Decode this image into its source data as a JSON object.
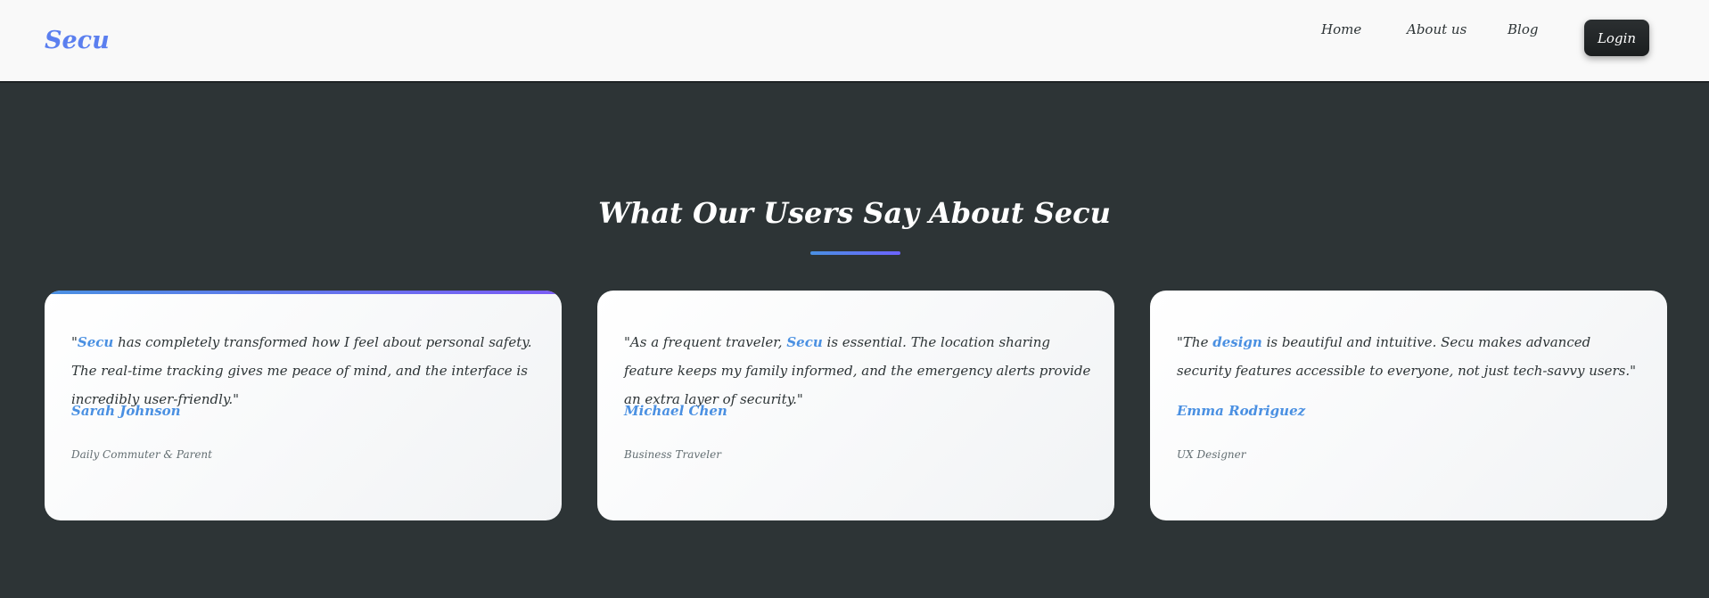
{
  "nav": {
    "logo": "Secu",
    "links": [
      "Home",
      "About us",
      "Blog"
    ],
    "login_label": "Login"
  },
  "section": {
    "title": "What Our Users Say About Secu"
  },
  "testimonials": [
    {
      "quote_before": "\"",
      "highlight": "Secu",
      "quote_after": " has completely transformed how I feel about personal safety. The real-time tracking gives me peace of mind, and the interface is incredibly user-friendly.\"",
      "author": "Sarah Johnson",
      "role": "Daily Commuter & Parent"
    },
    {
      "quote_before": "\"As a frequent traveler, ",
      "highlight": "Secu",
      "quote_after": " is essential. The location sharing feature keeps my family informed, and the emergency alerts provide an extra layer of security.\"",
      "author": "Michael Chen",
      "role": "Business Traveler"
    },
    {
      "quote_before": "\"The ",
      "highlight": "design",
      "quote_after": " is beautiful and intuitive. Secu makes advanced security features accessible to everyone, not just tech-savvy users.\"",
      "author": "Emma Rodriguez",
      "role": "UX Designer"
    }
  ],
  "colors": {
    "accent": "#4a90e2",
    "accent_secondary": "#6c63ff",
    "background": "#2d3436",
    "navbar": "#f9f9f9",
    "login_button": "#1e2224"
  }
}
